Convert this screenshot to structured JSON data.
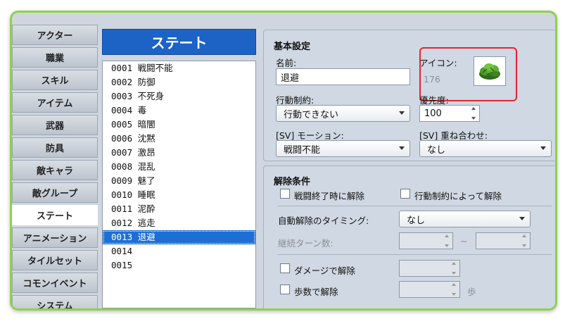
{
  "sidebar": {
    "tabs": [
      "アクター",
      "職業",
      "スキル",
      "アイテム",
      "武器",
      "防具",
      "敵キャラ",
      "敵グループ",
      "ステート",
      "アニメーション",
      "タイルセット",
      "コモンイベント",
      "システム"
    ],
    "active_index": 8
  },
  "state_list": {
    "header": "ステート",
    "rows": [
      {
        "id": "0001",
        "name": "戦闘不能"
      },
      {
        "id": "0002",
        "name": "防御"
      },
      {
        "id": "0003",
        "name": "不死身"
      },
      {
        "id": "0004",
        "name": "毒"
      },
      {
        "id": "0005",
        "name": "暗闇"
      },
      {
        "id": "0006",
        "name": "沈黙"
      },
      {
        "id": "0007",
        "name": "激昂"
      },
      {
        "id": "0008",
        "name": "混乱"
      },
      {
        "id": "0009",
        "name": "魅了"
      },
      {
        "id": "0010",
        "name": "睡眠"
      },
      {
        "id": "0011",
        "name": "泥酔"
      },
      {
        "id": "0012",
        "name": "逃走"
      },
      {
        "id": "0013",
        "name": "退避"
      },
      {
        "id": "0014",
        "name": ""
      },
      {
        "id": "0015",
        "name": ""
      }
    ],
    "selected_index": 12
  },
  "basic": {
    "title": "基本設定",
    "name_label": "名前:",
    "name_value": "退避",
    "icon_label": "アイコン:",
    "icon_index": "176",
    "restriction_label": "行動制約:",
    "restriction_value": "行動できない",
    "priority_label": "優先度:",
    "priority_value": "100",
    "motion_label": "[SV] モーション:",
    "motion_value": "戦闘不能",
    "overlay_label": "[SV] 重ね合わせ:",
    "overlay_value": "なし"
  },
  "removal": {
    "title": "解除条件",
    "remove_battle_end": "戦闘終了時に解除",
    "remove_by_restriction": "行動制約によって解除",
    "auto_removal_label": "自動解除のタイミング:",
    "auto_removal_value": "なし",
    "duration_label": "継続ターン数:",
    "tilde": "~",
    "remove_by_damage": "ダメージで解除",
    "remove_by_walking": "歩数で解除",
    "steps_unit": "歩"
  },
  "colors": {
    "frame_border": "#8fd14b",
    "list_header": "#1c63c5",
    "selection": "#1d6fd6",
    "highlight": "#e2262f"
  }
}
